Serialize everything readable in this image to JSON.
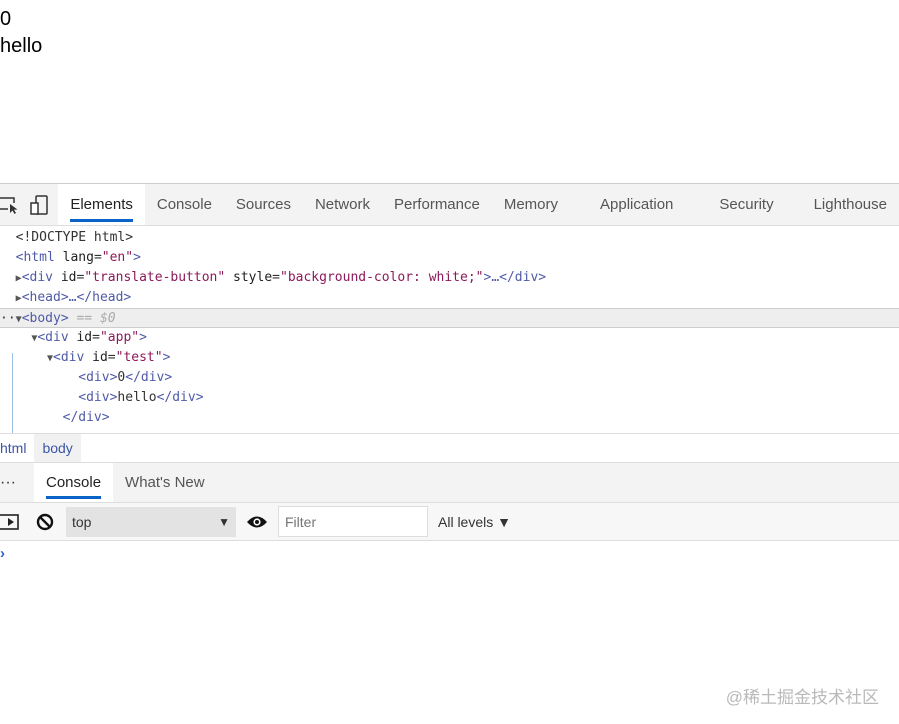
{
  "page": {
    "lines": [
      "0",
      "hello"
    ]
  },
  "devtools": {
    "tabs": [
      "Elements",
      "Console",
      "Sources",
      "Network",
      "Performance",
      "Memory",
      "Application",
      "Security",
      "Lighthouse"
    ],
    "active_tab": "Elements",
    "tree": {
      "doctype": "<!DOCTYPE html>",
      "html_open": "<html",
      "html_attr": "lang",
      "html_val": "\"en\"",
      "translate_tag": "<div",
      "translate_id_val": "\"translate-button\"",
      "translate_style_val": "\"background-color: white;\"",
      "translate_close": ">…</div>",
      "head": "<head>…</head>",
      "body": "<body>",
      "body_marker": "== $0",
      "app_val": "\"app\"",
      "test_val": "\"test\"",
      "child1": "0",
      "child2": "hello"
    },
    "breadcrumbs": [
      "html",
      "body"
    ],
    "drawer_tabs": [
      "Console",
      "What's New"
    ],
    "console": {
      "context": "top",
      "filter_placeholder": "Filter",
      "levels": "All levels ▼",
      "prompt": "›"
    }
  },
  "watermark": "@稀土掘金技术社区"
}
